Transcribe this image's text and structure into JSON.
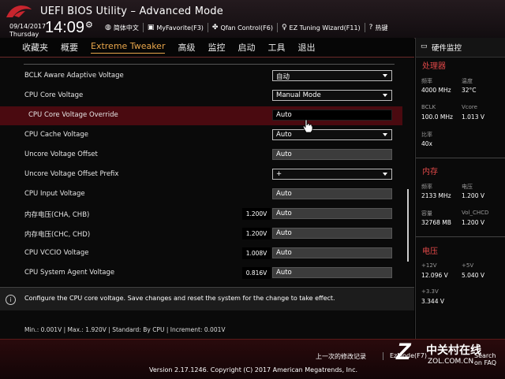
{
  "header": {
    "title": "UEFI BIOS Utility – Advanced Mode",
    "date": "09/14/2017",
    "weekday": "Thursday",
    "time": "14:09",
    "tools": [
      {
        "icon": "globe-icon",
        "label": "简体中文"
      },
      {
        "icon": "favorite-icon",
        "label": "MyFavorite(F3)"
      },
      {
        "icon": "fan-icon",
        "label": "Qfan Control(F6)"
      },
      {
        "icon": "bulb-icon",
        "label": "EZ Tuning Wizard(F11)"
      },
      {
        "icon": "help-icon",
        "label": "热键"
      }
    ]
  },
  "menu": [
    "收藏夹",
    "概要",
    "Extreme Tweaker",
    "高级",
    "监控",
    "启动",
    "工具",
    "退出"
  ],
  "rows": [
    {
      "label": "BCLK Aware Adaptive Voltage",
      "value": "自动",
      "type": "select"
    },
    {
      "label": "CPU Core Voltage",
      "value": "Manual Mode",
      "type": "select"
    },
    {
      "label": "CPU Core Voltage Override",
      "value": "Auto",
      "type": "box-dark",
      "highlight": true
    },
    {
      "label": "CPU Cache Voltage",
      "value": "Auto",
      "type": "select"
    },
    {
      "label": "Uncore Voltage Offset",
      "value": "Auto",
      "type": "box"
    },
    {
      "label": "Uncore Voltage Offset Prefix",
      "value": "+",
      "type": "select"
    },
    {
      "label": "CPU Input Voltage",
      "value": "Auto",
      "type": "box"
    },
    {
      "label": "内存电压(CHA, CHB)",
      "value": "Auto",
      "type": "box",
      "current": "1.200V"
    },
    {
      "label": "内存电压(CHC, CHD)",
      "value": "Auto",
      "type": "box",
      "current": "1.200V"
    },
    {
      "label": "CPU VCCIO Voltage",
      "value": "Auto",
      "type": "box",
      "current": "1.008V"
    },
    {
      "label": "CPU System Agent Voltage",
      "value": "Auto",
      "type": "box",
      "current": "0.816V"
    }
  ],
  "info": "Configure the CPU core voltage. Save changes and reset the system for the change to take effect.",
  "limits": "Min.: 0.001V   |   Max.: 1.920V   |   Standard: By CPU   |   Increment: 0.001V",
  "monitor": {
    "title": "硬件监控",
    "cpu": {
      "heading": "处理器",
      "freq_k": "频率",
      "freq_v": "4000 MHz",
      "temp_k": "温度",
      "temp_v": "32°C",
      "bclk_k": "BCLK",
      "bclk_v": "100.0 MHz",
      "vcore_k": "Vcore",
      "vcore_v": "1.013 V",
      "ratio_k": "比率",
      "ratio_v": "40x"
    },
    "mem": {
      "heading": "内存",
      "freq_k": "频率",
      "freq_v": "2133 MHz",
      "volt_k": "电压",
      "volt_v": "1.200 V",
      "cap_k": "容量",
      "cap_v": "32768 MB",
      "chcd_k": "Vol_CHCD",
      "chcd_v": "1.200 V"
    },
    "volt": {
      "heading": "电压",
      "v12_k": "+12V",
      "v12_v": "12.096 V",
      "v5_k": "+5V",
      "v5_v": "5.040 V",
      "v33_k": "+3.3V",
      "v33_v": "3.344 V"
    }
  },
  "footer": {
    "last_modified": "上一次的修改记录",
    "ezmode": "EzMode(F7)",
    "faq": "Search on FAQ",
    "version": "Version 2.17.1246. Copyright (C) 2017 American Megatrends, Inc."
  },
  "watermark": {
    "brand": "中关村在线",
    "url": "ZOL.COM.CN"
  },
  "colors": {
    "accent": "#e8a64b",
    "highlight": "#4a0a10",
    "section": "#e04848"
  }
}
